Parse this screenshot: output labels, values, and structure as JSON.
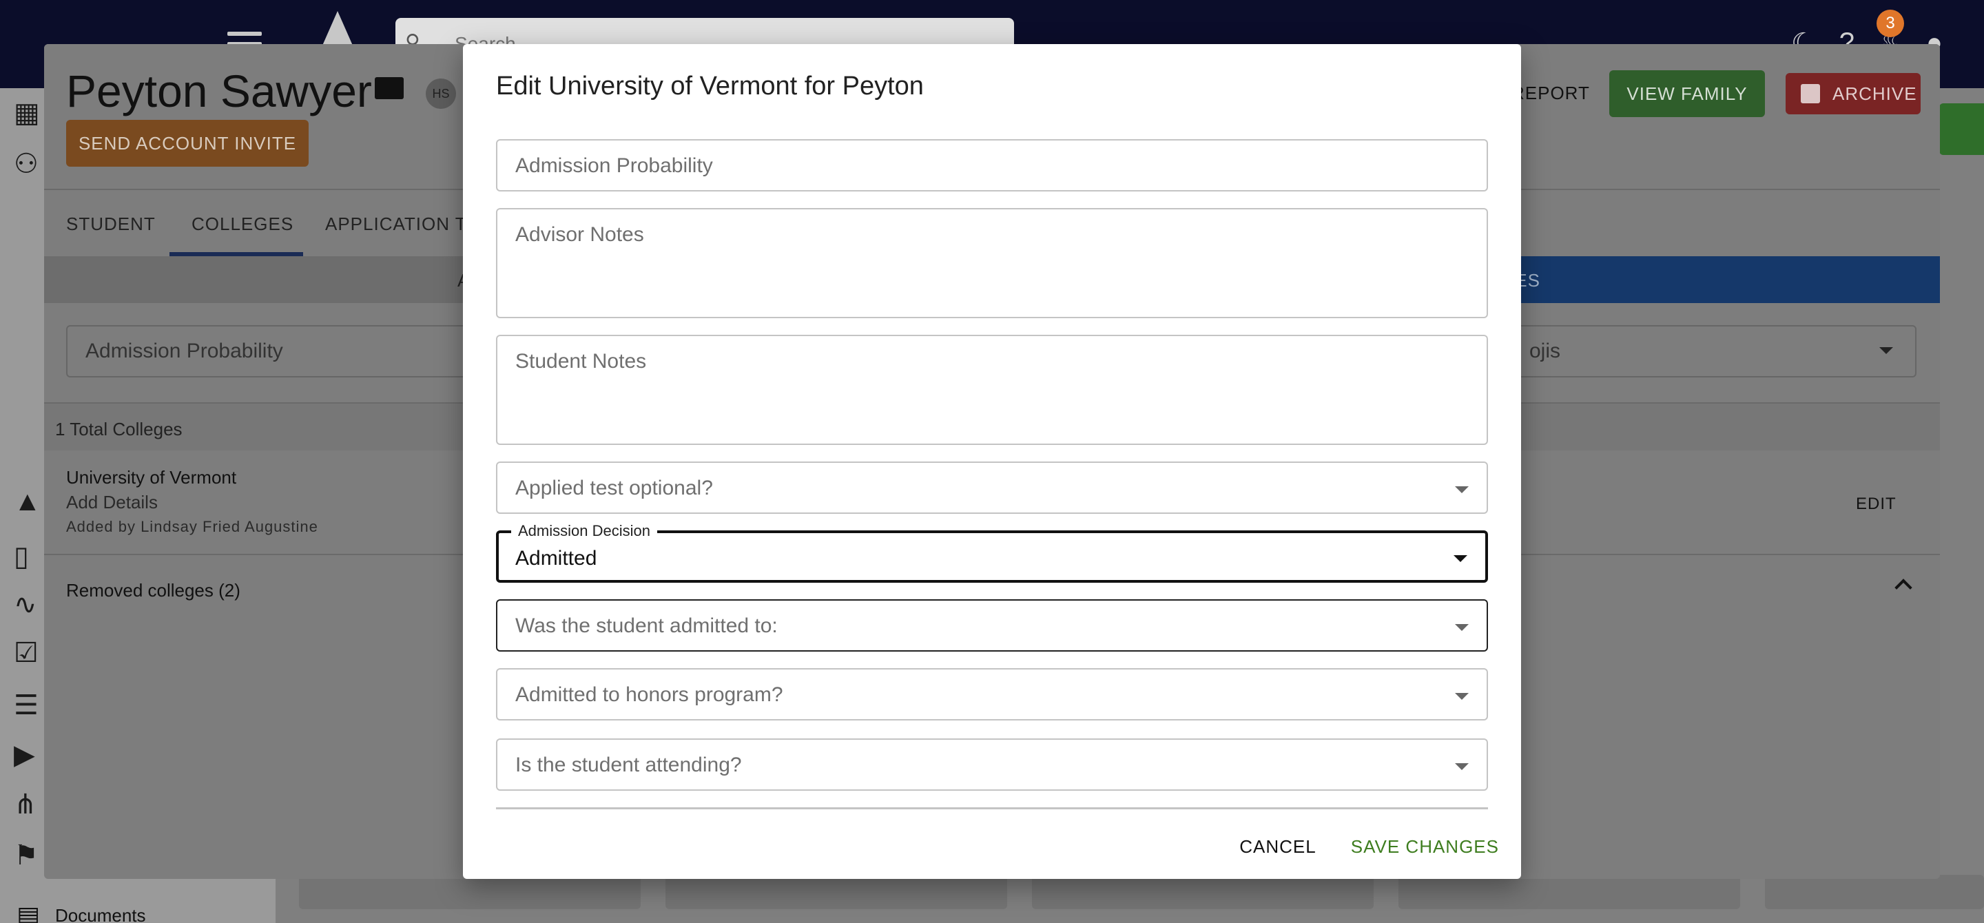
{
  "topbar": {
    "search_placeholder": "Search",
    "notification_count": "3",
    "icons": [
      "menu-icon",
      "app-logo",
      "search-icon",
      "dark-mode-icon",
      "help-icon",
      "bell-icon",
      "account-icon"
    ]
  },
  "leftnav": {
    "documents_label": "Documents",
    "icons": [
      "dashboard-icon",
      "people-icon",
      "school-icon",
      "columns-icon",
      "chart-icon",
      "checklist-icon",
      "list-icon",
      "video-icon",
      "merge-icon",
      "reading-icon",
      "document-icon"
    ]
  },
  "student": {
    "name": "Peyton Sawyer",
    "badge": "HS",
    "send_invite_label": "SEND ACCOUNT INVITE",
    "report_label": "REPORT",
    "view_family_label": "VIEW FAMILY",
    "archive_label": "ARCHIVE"
  },
  "tabs": [
    {
      "label": "STUDENT",
      "active": false
    },
    {
      "label": "COLLEGES",
      "active": true
    },
    {
      "label": "APPLICATION TR",
      "active": false
    }
  ],
  "subbar": {
    "left_partial": "A",
    "right_partial": "GES"
  },
  "filters": {
    "admission_probability": "Admission Probability",
    "emojis_partial": "ojis"
  },
  "colleges": {
    "total_label": "1 Total Colleges",
    "items": [
      {
        "name": "University of Vermont",
        "add_details": "Add Details",
        "added_by": "Added by Lindsay Fried Augustine",
        "edit_label": "EDIT"
      }
    ],
    "removed_label": "Removed colleges (2)"
  },
  "modal": {
    "title": "Edit University of Vermont for Peyton",
    "fields": {
      "admission_probability": "Admission Probability",
      "advisor_notes": "Advisor Notes",
      "student_notes": "Student Notes",
      "applied_test_optional": "Applied test optional?",
      "admission_decision_label": "Admission Decision",
      "admission_decision_value": "Admitted",
      "admitted_to": "Was the student admitted to:",
      "honors_program": "Admitted to honors program?",
      "attending": "Is the student attending?"
    },
    "cancel_label": "CANCEL",
    "save_label": "SAVE CHANGES",
    "colors": {
      "save": "#3e7d1f",
      "focus_border": "#111111"
    }
  }
}
